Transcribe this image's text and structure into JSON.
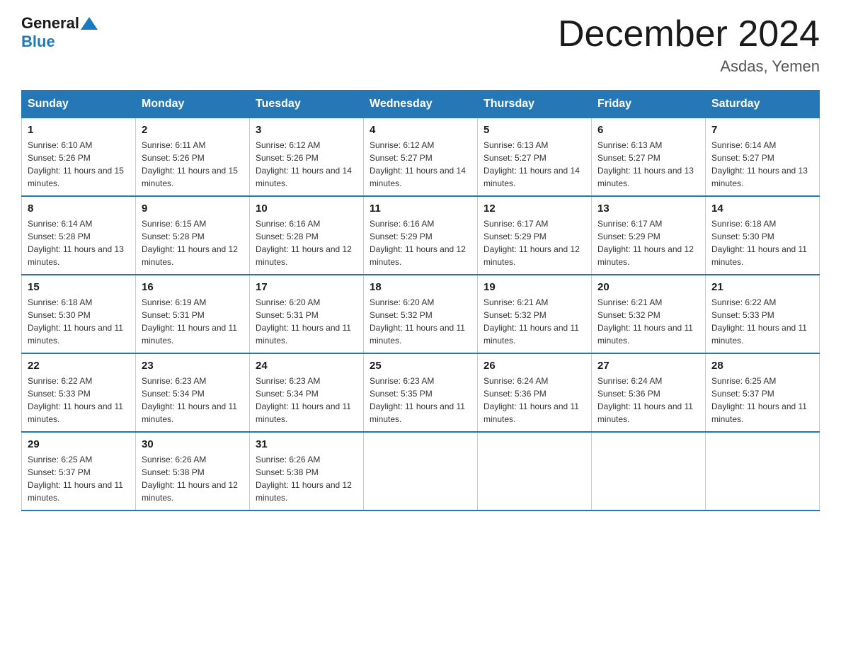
{
  "logo": {
    "general": "General",
    "blue": "Blue"
  },
  "title": "December 2024",
  "subtitle": "Asdas, Yemen",
  "days_of_week": [
    "Sunday",
    "Monday",
    "Tuesday",
    "Wednesday",
    "Thursday",
    "Friday",
    "Saturday"
  ],
  "weeks": [
    [
      {
        "day": "1",
        "sunrise": "6:10 AM",
        "sunset": "5:26 PM",
        "daylight": "11 hours and 15 minutes."
      },
      {
        "day": "2",
        "sunrise": "6:11 AM",
        "sunset": "5:26 PM",
        "daylight": "11 hours and 15 minutes."
      },
      {
        "day": "3",
        "sunrise": "6:12 AM",
        "sunset": "5:26 PM",
        "daylight": "11 hours and 14 minutes."
      },
      {
        "day": "4",
        "sunrise": "6:12 AM",
        "sunset": "5:27 PM",
        "daylight": "11 hours and 14 minutes."
      },
      {
        "day": "5",
        "sunrise": "6:13 AM",
        "sunset": "5:27 PM",
        "daylight": "11 hours and 14 minutes."
      },
      {
        "day": "6",
        "sunrise": "6:13 AM",
        "sunset": "5:27 PM",
        "daylight": "11 hours and 13 minutes."
      },
      {
        "day": "7",
        "sunrise": "6:14 AM",
        "sunset": "5:27 PM",
        "daylight": "11 hours and 13 minutes."
      }
    ],
    [
      {
        "day": "8",
        "sunrise": "6:14 AM",
        "sunset": "5:28 PM",
        "daylight": "11 hours and 13 minutes."
      },
      {
        "day": "9",
        "sunrise": "6:15 AM",
        "sunset": "5:28 PM",
        "daylight": "11 hours and 12 minutes."
      },
      {
        "day": "10",
        "sunrise": "6:16 AM",
        "sunset": "5:28 PM",
        "daylight": "11 hours and 12 minutes."
      },
      {
        "day": "11",
        "sunrise": "6:16 AM",
        "sunset": "5:29 PM",
        "daylight": "11 hours and 12 minutes."
      },
      {
        "day": "12",
        "sunrise": "6:17 AM",
        "sunset": "5:29 PM",
        "daylight": "11 hours and 12 minutes."
      },
      {
        "day": "13",
        "sunrise": "6:17 AM",
        "sunset": "5:29 PM",
        "daylight": "11 hours and 12 minutes."
      },
      {
        "day": "14",
        "sunrise": "6:18 AM",
        "sunset": "5:30 PM",
        "daylight": "11 hours and 11 minutes."
      }
    ],
    [
      {
        "day": "15",
        "sunrise": "6:18 AM",
        "sunset": "5:30 PM",
        "daylight": "11 hours and 11 minutes."
      },
      {
        "day": "16",
        "sunrise": "6:19 AM",
        "sunset": "5:31 PM",
        "daylight": "11 hours and 11 minutes."
      },
      {
        "day": "17",
        "sunrise": "6:20 AM",
        "sunset": "5:31 PM",
        "daylight": "11 hours and 11 minutes."
      },
      {
        "day": "18",
        "sunrise": "6:20 AM",
        "sunset": "5:32 PM",
        "daylight": "11 hours and 11 minutes."
      },
      {
        "day": "19",
        "sunrise": "6:21 AM",
        "sunset": "5:32 PM",
        "daylight": "11 hours and 11 minutes."
      },
      {
        "day": "20",
        "sunrise": "6:21 AM",
        "sunset": "5:32 PM",
        "daylight": "11 hours and 11 minutes."
      },
      {
        "day": "21",
        "sunrise": "6:22 AM",
        "sunset": "5:33 PM",
        "daylight": "11 hours and 11 minutes."
      }
    ],
    [
      {
        "day": "22",
        "sunrise": "6:22 AM",
        "sunset": "5:33 PM",
        "daylight": "11 hours and 11 minutes."
      },
      {
        "day": "23",
        "sunrise": "6:23 AM",
        "sunset": "5:34 PM",
        "daylight": "11 hours and 11 minutes."
      },
      {
        "day": "24",
        "sunrise": "6:23 AM",
        "sunset": "5:34 PM",
        "daylight": "11 hours and 11 minutes."
      },
      {
        "day": "25",
        "sunrise": "6:23 AM",
        "sunset": "5:35 PM",
        "daylight": "11 hours and 11 minutes."
      },
      {
        "day": "26",
        "sunrise": "6:24 AM",
        "sunset": "5:36 PM",
        "daylight": "11 hours and 11 minutes."
      },
      {
        "day": "27",
        "sunrise": "6:24 AM",
        "sunset": "5:36 PM",
        "daylight": "11 hours and 11 minutes."
      },
      {
        "day": "28",
        "sunrise": "6:25 AM",
        "sunset": "5:37 PM",
        "daylight": "11 hours and 11 minutes."
      }
    ],
    [
      {
        "day": "29",
        "sunrise": "6:25 AM",
        "sunset": "5:37 PM",
        "daylight": "11 hours and 11 minutes."
      },
      {
        "day": "30",
        "sunrise": "6:26 AM",
        "sunset": "5:38 PM",
        "daylight": "11 hours and 12 minutes."
      },
      {
        "day": "31",
        "sunrise": "6:26 AM",
        "sunset": "5:38 PM",
        "daylight": "11 hours and 12 minutes."
      },
      null,
      null,
      null,
      null
    ]
  ]
}
